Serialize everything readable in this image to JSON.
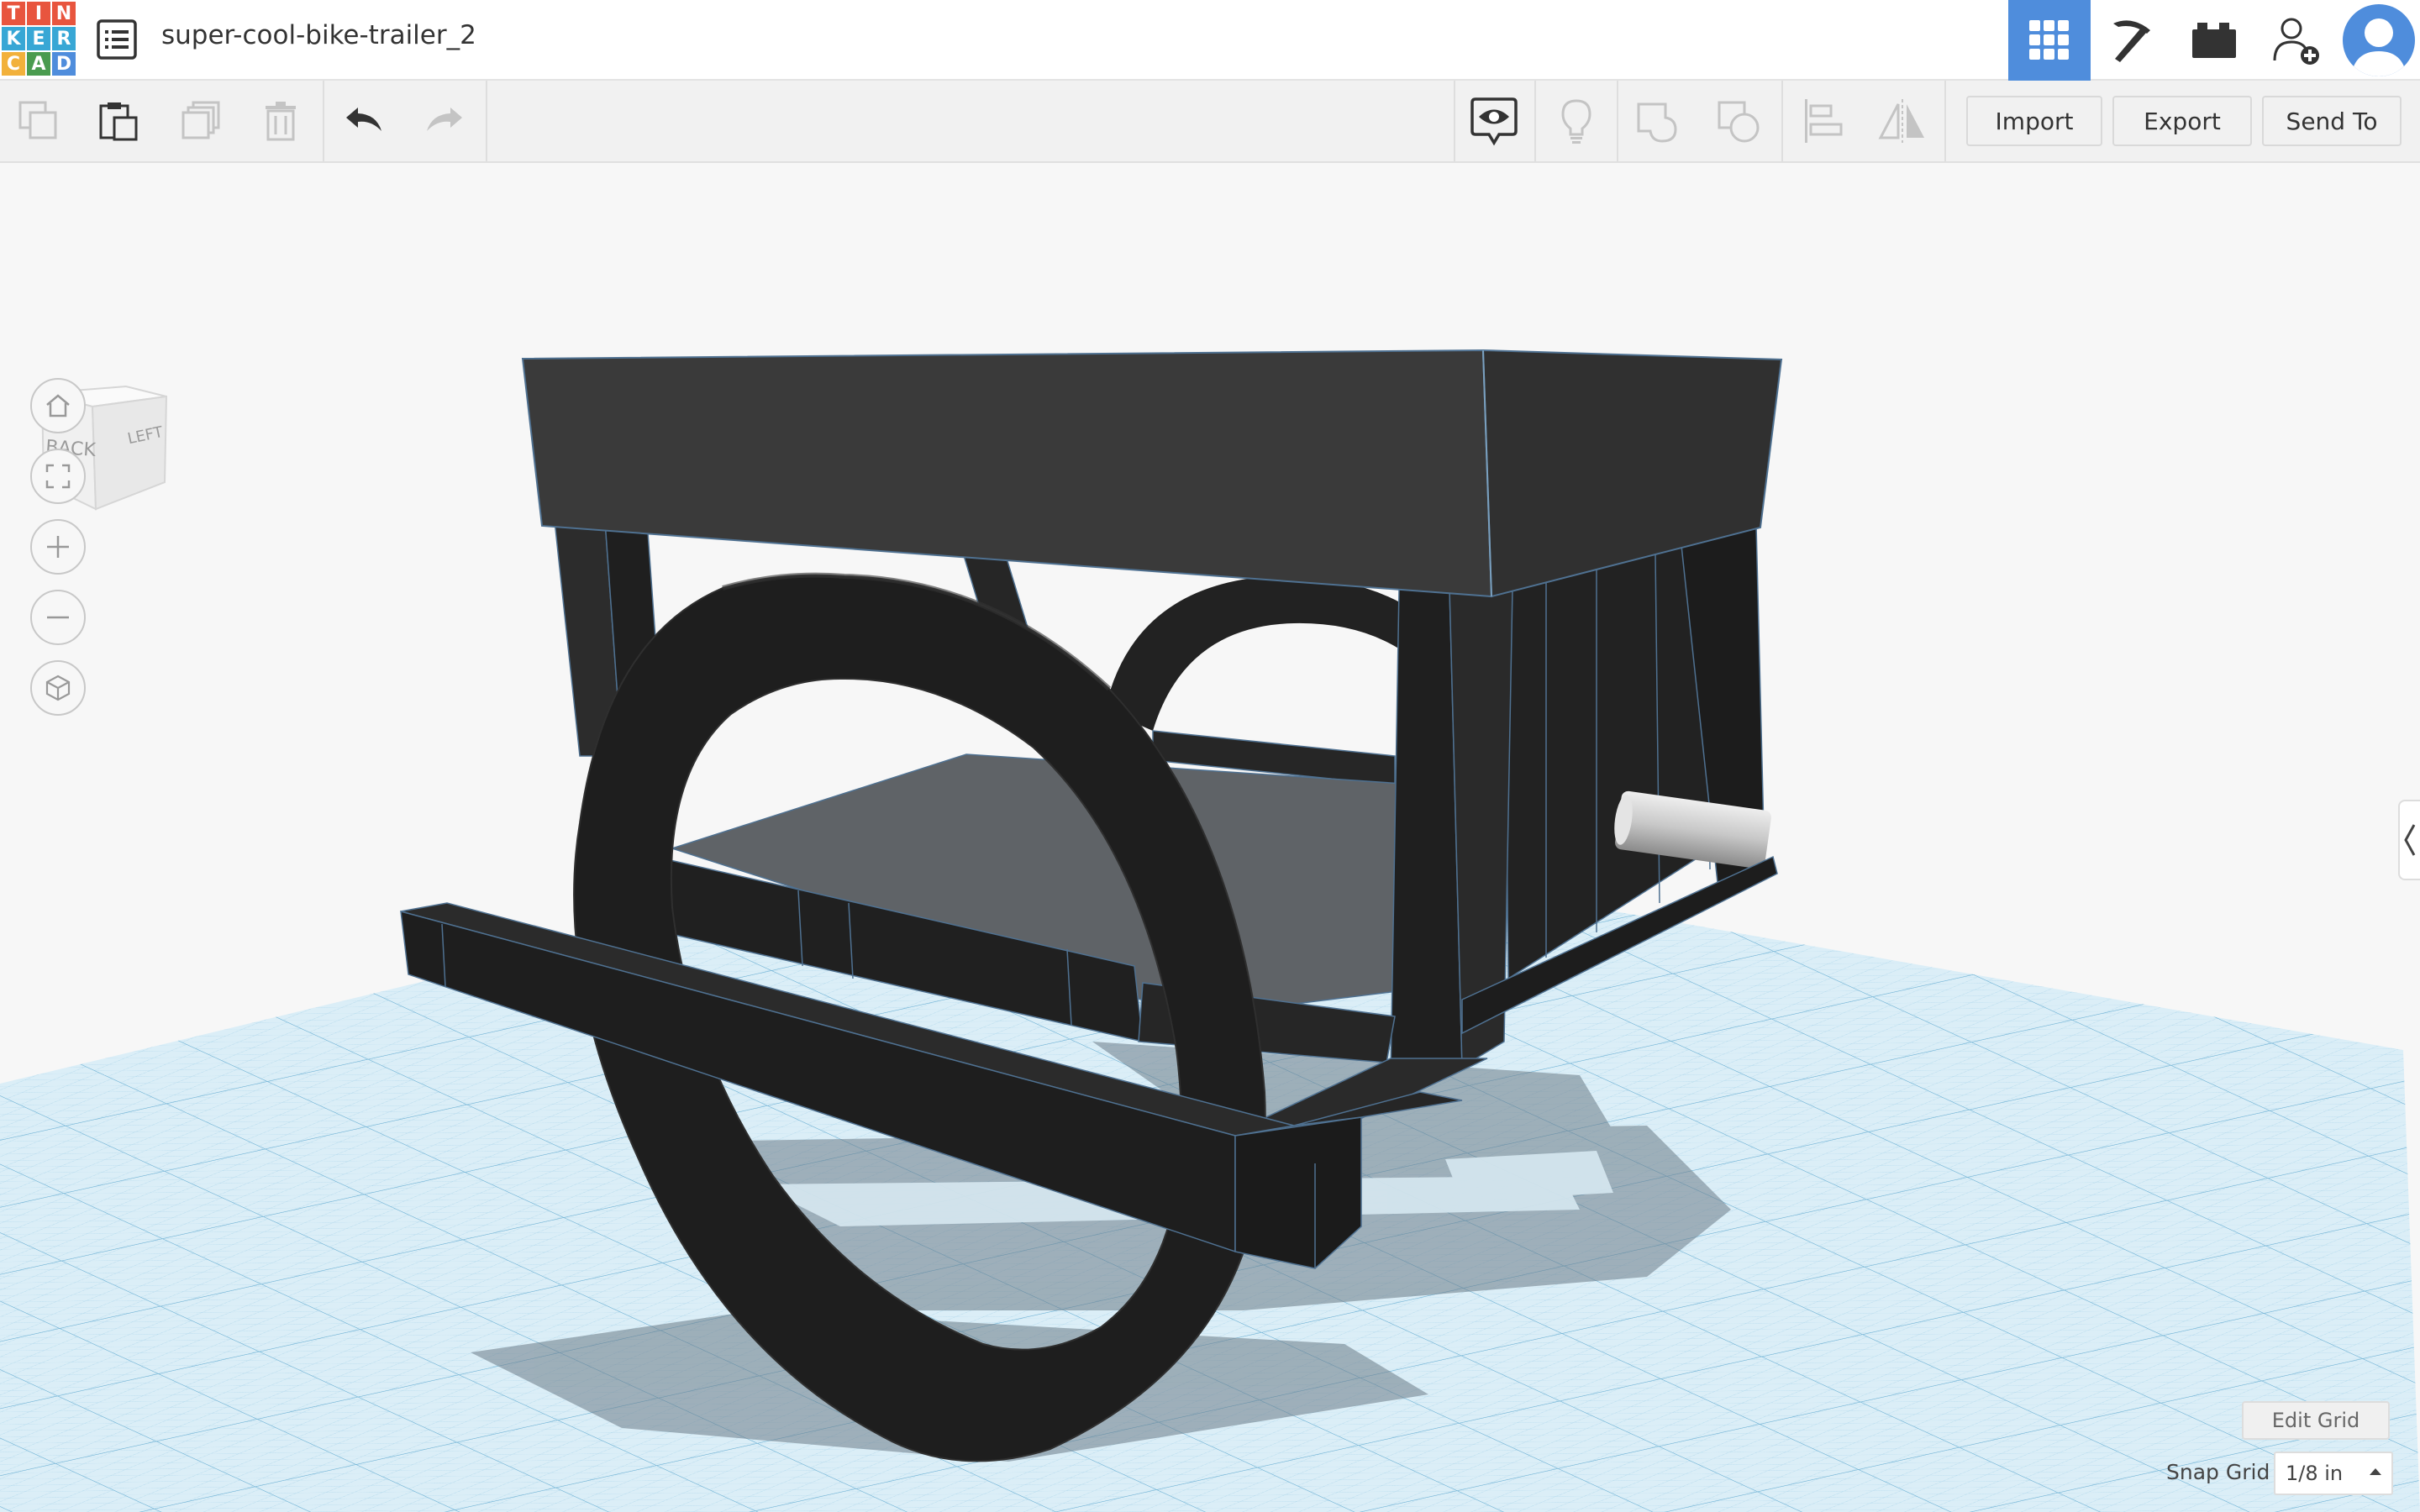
{
  "app": {
    "logo_letters": [
      "T",
      "I",
      "N",
      "K",
      "E",
      "R",
      "C",
      "A",
      "D"
    ],
    "logo_colors": [
      "#e8553e",
      "#e8553e",
      "#e8553e",
      "#38a7d5",
      "#38a7d5",
      "#38a7d5",
      "#f2b13b",
      "#4a9b4f",
      "#4f8ddc"
    ],
    "document_title": "super-cool-bike-trailer_2",
    "accent_color": "#4f8ddc"
  },
  "topbar": {
    "menu_icon": "list-icon",
    "buttons": [
      {
        "name": "3d-design-view",
        "icon": "grid-icon",
        "active": true
      },
      {
        "name": "blocks-view",
        "icon": "pickaxe-icon",
        "active": false
      },
      {
        "name": "bricks-view",
        "icon": "brick-icon",
        "active": false
      },
      {
        "name": "invite-user",
        "icon": "add-user-icon",
        "active": false
      }
    ],
    "avatar_icon": "user-avatar-icon"
  },
  "toolbar": {
    "copy_icon": "copy-icon",
    "paste_icon": "paste-icon",
    "duplicate_icon": "duplicate-icon",
    "delete_icon": "trash-icon",
    "undo_icon": "undo-icon",
    "redo_icon": "redo-icon",
    "notes_icon": "notes-eye-icon",
    "light_icon": "lightbulb-icon",
    "group_icon": "group-icon",
    "ungroup_icon": "ungroup-icon",
    "align_icon": "align-icon",
    "mirror_icon": "mirror-icon",
    "import_label": "Import",
    "export_label": "Export",
    "send_to_label": "Send To"
  },
  "viewcube": {
    "face_front": "BACK",
    "face_side": "LEFT"
  },
  "nav": [
    {
      "name": "home-view",
      "icon": "home-icon"
    },
    {
      "name": "fit-all",
      "icon": "fit-icon"
    },
    {
      "name": "zoom-in",
      "icon": "plus-icon"
    },
    {
      "name": "zoom-out",
      "icon": "minus-icon"
    },
    {
      "name": "ortho-toggle",
      "icon": "cube-icon"
    }
  ],
  "grid": {
    "edit_grid_label": "Edit Grid",
    "snap_grid_label": "Snap Grid",
    "snap_grid_value": "1/8 in"
  }
}
